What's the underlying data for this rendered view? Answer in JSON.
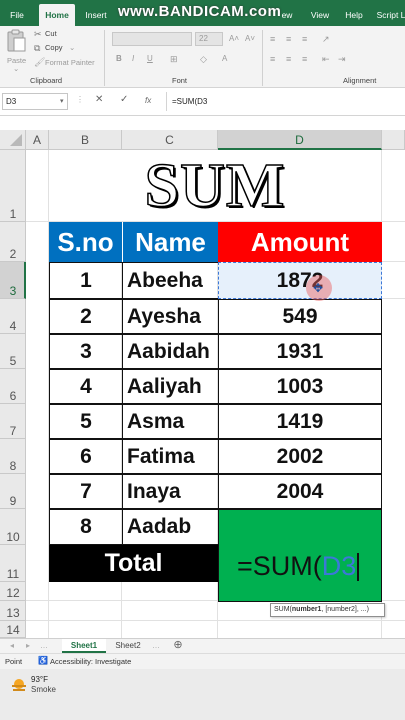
{
  "ribbon_tabs": [
    "File",
    "Home",
    "Insert",
    "ew",
    "View",
    "Help",
    "Script L"
  ],
  "active_tab": "Home",
  "watermark": "www.BANDICAM.com",
  "clipboard": {
    "paste": "Paste",
    "cut": "Cut",
    "copy": "Copy",
    "format_painter": "Format Painter",
    "group": "Clipboard"
  },
  "font": {
    "size": "22",
    "group": "Font",
    "bold": "B",
    "italic": "I",
    "underline": "U"
  },
  "alignment": {
    "group": "Alignment"
  },
  "formula_bar": {
    "name_box": "D3",
    "fx": "fx",
    "formula": "=SUM(D3"
  },
  "columns": [
    "A",
    "B",
    "C",
    "D"
  ],
  "rows": [
    "1",
    "2",
    "3",
    "4",
    "5",
    "6",
    "7",
    "8",
    "9",
    "10",
    "11",
    "12",
    "13",
    "14"
  ],
  "title": "SUM",
  "table": {
    "headers": [
      "S.no",
      "Name",
      "Amount"
    ],
    "rows": [
      {
        "sno": "1",
        "name": "Abeeha",
        "amount": "1872"
      },
      {
        "sno": "2",
        "name": "Ayesha",
        "amount": "549"
      },
      {
        "sno": "3",
        "name": "Aabidah",
        "amount": "1931"
      },
      {
        "sno": "4",
        "name": "Aaliyah",
        "amount": "1003"
      },
      {
        "sno": "5",
        "name": "Asma",
        "amount": "1419"
      },
      {
        "sno": "6",
        "name": "Fatima",
        "amount": "2002"
      },
      {
        "sno": "7",
        "name": "Inaya",
        "amount": "2004"
      },
      {
        "sno": "8",
        "name": "Aadab",
        "amount": ""
      }
    ],
    "total_label": "Total",
    "formula_prefix": "=SUM(",
    "formula_ref": "D3"
  },
  "tooltip": {
    "func": "SUM(",
    "arg1": "number1",
    "rest": ", [number2], ...)"
  },
  "sheet_tabs": [
    "Sheet1",
    "Sheet2"
  ],
  "active_sheet": "Sheet1",
  "status": {
    "mode": "Point",
    "accessibility": "Accessibility: Investigate"
  },
  "weather": {
    "temp": "93°F",
    "desc": "Smoke"
  },
  "colors": {
    "excel_green": "#217346",
    "header_blue": "#0070c0",
    "header_red": "#ff0000",
    "total_green": "#00b050",
    "ref_blue": "#3c78d8"
  }
}
